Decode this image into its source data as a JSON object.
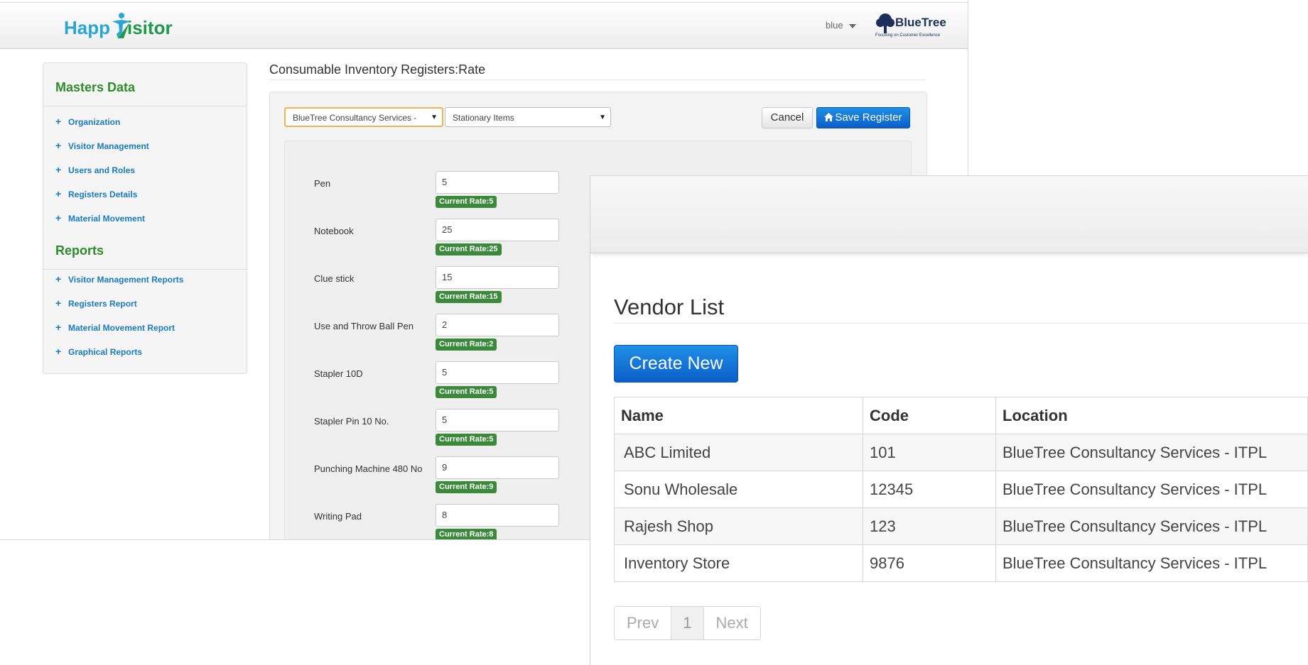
{
  "header": {
    "app_logo_text": "HappyVisitor",
    "user_menu_label": "blue",
    "brand_name": "BlueTree",
    "brand_tagline": "Focusing on Customer Excellence"
  },
  "sidebar": {
    "masters_heading": "Masters Data",
    "masters_items": [
      "Organization",
      "Visitor Management",
      "Users and Roles",
      "Registers Details",
      "Material Movement"
    ],
    "reports_heading": "Reports",
    "reports_items": [
      "Visitor Management Reports",
      "Registers Report",
      "Material Movement Report",
      "Graphical Reports"
    ]
  },
  "main": {
    "title": "Consumable Inventory Registers:Rate",
    "location_select": "BlueTree Consultancy Services -",
    "category_select": "Stationary Items",
    "cancel_label": "Cancel",
    "save_label": "Save Register",
    "items": [
      {
        "name": "Pen",
        "value": "5",
        "current": "Current Rate:5"
      },
      {
        "name": "Notebook",
        "value": "25",
        "current": "Current Rate:25"
      },
      {
        "name": "Clue stick",
        "value": "15",
        "current": "Current Rate:15"
      },
      {
        "name": "Use and Throw Ball Pen",
        "value": "2",
        "current": "Current Rate:2"
      },
      {
        "name": "Stapler 10D",
        "value": "5",
        "current": "Current Rate:5"
      },
      {
        "name": "Stapler Pin 10 No.",
        "value": "5",
        "current": "Current Rate:5"
      },
      {
        "name": "Punching Machine 480 No",
        "value": "9",
        "current": "Current Rate:9"
      },
      {
        "name": "Writing Pad",
        "value": "8",
        "current": "Current Rate:8"
      }
    ]
  },
  "vendor": {
    "title": "Vendor List",
    "create_label": "Create New",
    "columns": [
      "Name",
      "Code",
      "Location"
    ],
    "rows": [
      [
        "ABC Limited",
        "101",
        "BlueTree Consultancy Services - ITPL"
      ],
      [
        "Sonu Wholesale",
        "12345",
        "BlueTree Consultancy Services - ITPL"
      ],
      [
        "Rajesh Shop",
        "123",
        "BlueTree Consultancy Services - ITPL"
      ],
      [
        "Inventory Store",
        "9876",
        "BlueTree Consultancy Services - ITPL"
      ]
    ],
    "pagination": {
      "prev": "Prev",
      "current": "1",
      "next": "Next"
    }
  },
  "colors": {
    "primary_blue": "#0b5fc9",
    "sidebar_heading_green": "#2e8b2e",
    "badge_green": "#3b8a3b",
    "link_blue": "#1a7bc0"
  },
  "icons": [
    "plus-icon",
    "home-icon",
    "caret-down-icon"
  ]
}
